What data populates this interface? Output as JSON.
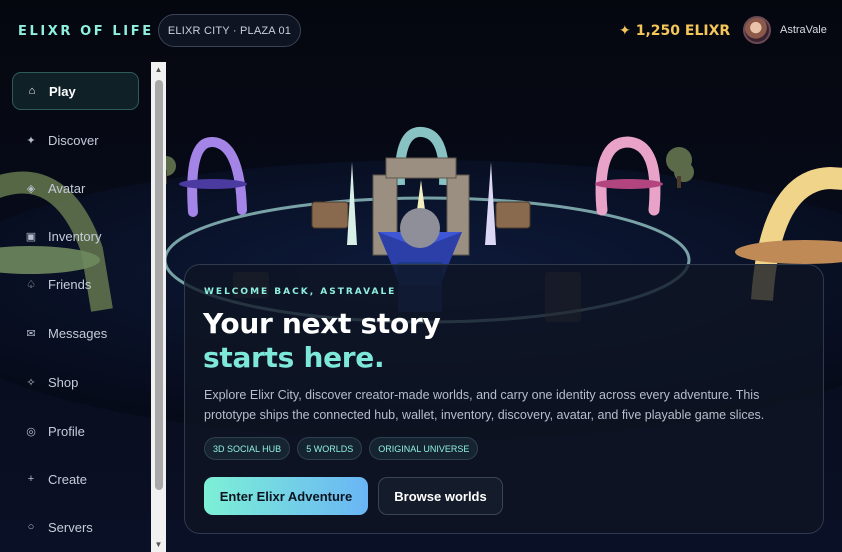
{
  "header": {
    "brand": "ELIXR OF LIFE",
    "location": "ELIXR CITY · PLAZA 01",
    "balance_icon": "sparkle-icon",
    "balance": "1,250 ELIXR",
    "username": "AstraVale"
  },
  "sidebar": {
    "items": [
      {
        "label": "Play",
        "icon": "⌂",
        "active": true
      },
      {
        "label": "Discover",
        "icon": "✦",
        "active": false
      },
      {
        "label": "Avatar",
        "icon": "◈",
        "active": false
      },
      {
        "label": "Inventory",
        "icon": "▣",
        "active": false
      },
      {
        "label": "Friends",
        "icon": "♤",
        "active": false
      },
      {
        "label": "Messages",
        "icon": "✉",
        "active": false
      },
      {
        "label": "Shop",
        "icon": "✧",
        "active": false
      },
      {
        "label": "Profile",
        "icon": "◎",
        "active": false
      },
      {
        "label": "Create",
        "icon": "+",
        "active": false
      },
      {
        "label": "Servers",
        "icon": "○",
        "active": false
      }
    ]
  },
  "hero": {
    "eyebrow": "WELCOME BACK, ASTRAVALE",
    "headline_line1": "Your next story",
    "headline_line2": "starts here.",
    "description": "Explore Elixr City, discover creator-made worlds, and carry one identity across every adventure. This prototype ships the connected hub, wallet, inventory, discovery, avatar, and five playable game slices.",
    "tags": [
      "3D SOCIAL HUB",
      "5 WORLDS",
      "ORIGINAL UNIVERSE"
    ],
    "primary_button": "Enter Elixr Adventure",
    "secondary_button": "Browse worlds"
  },
  "colors": {
    "accent": "#8ff0df",
    "gold": "#f5c75a",
    "background": "#070b1a"
  }
}
